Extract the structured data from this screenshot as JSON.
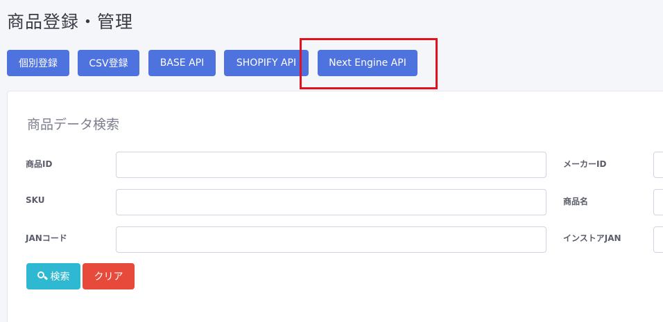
{
  "page": {
    "title": "商品登録・管理"
  },
  "toolbar": {
    "individual_label": "個別登録",
    "csv_label": "CSV登録",
    "base_label": "BASE API",
    "shopify_label": "SHOPIFY API",
    "nextengine_label": "Next Engine API"
  },
  "search": {
    "title": "商品データ検索",
    "fields": {
      "product_id": {
        "label": "商品ID",
        "value": ""
      },
      "maker_id": {
        "label": "メーカーID",
        "value": ""
      },
      "sku": {
        "label": "SKU",
        "value": ""
      },
      "product_name": {
        "label": "商品名",
        "value": ""
      },
      "jan_code": {
        "label": "JANコード",
        "value": ""
      },
      "instore_jan": {
        "label": "インストアJAN",
        "value": ""
      }
    },
    "search_label": "検索",
    "clear_label": "クリア"
  },
  "colors": {
    "primary": "#4e73df",
    "info": "#2eb8d1",
    "danger": "#e74a3b",
    "highlight": "#e3101e"
  }
}
